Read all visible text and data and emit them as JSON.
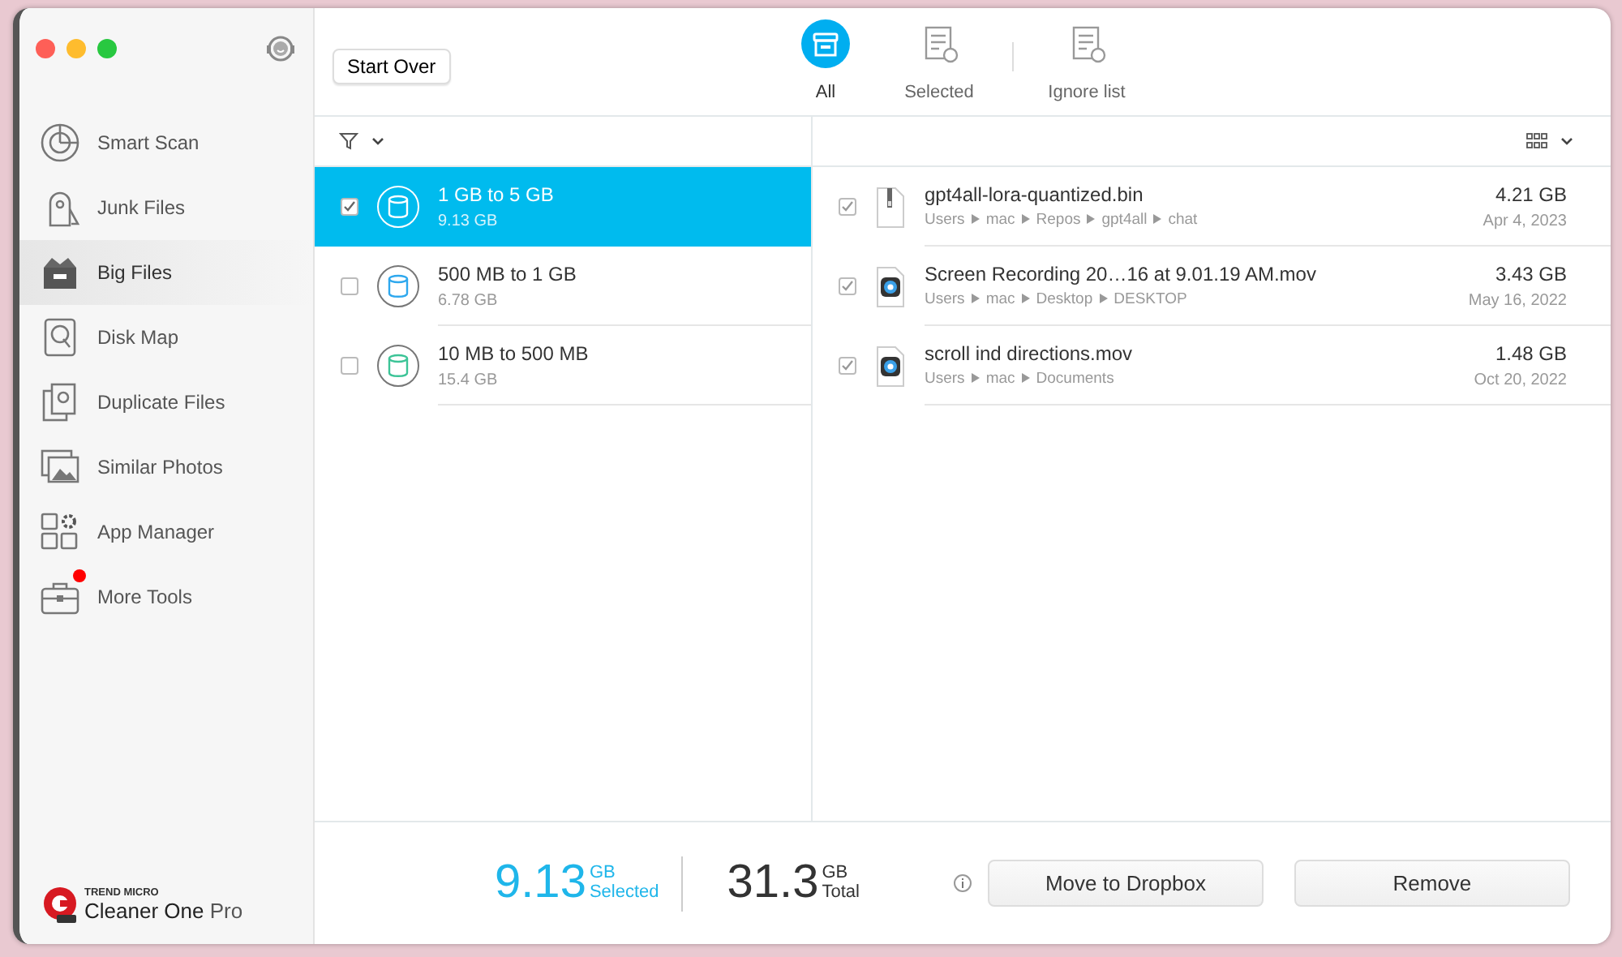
{
  "sidebar": {
    "items": [
      {
        "label": "Smart Scan",
        "selected": false,
        "badge": false
      },
      {
        "label": "Junk Files",
        "selected": false,
        "badge": false
      },
      {
        "label": "Big Files",
        "selected": true,
        "badge": false
      },
      {
        "label": "Disk Map",
        "selected": false,
        "badge": false
      },
      {
        "label": "Duplicate Files",
        "selected": false,
        "badge": false
      },
      {
        "label": "Similar Photos",
        "selected": false,
        "badge": false
      },
      {
        "label": "App Manager",
        "selected": false,
        "badge": false
      },
      {
        "label": "More Tools",
        "selected": false,
        "badge": true
      }
    ],
    "brand": {
      "company": "TREND MICRO",
      "product": "Cleaner One",
      "edition": "Pro"
    }
  },
  "toolbar": {
    "start_over": "Start Over",
    "tabs": [
      {
        "label": "All",
        "selected": true
      },
      {
        "label": "Selected",
        "selected": false
      },
      {
        "label": "Ignore list",
        "selected": false
      }
    ]
  },
  "groups": [
    {
      "label": "1 GB to 5 GB",
      "size": "9.13 GB",
      "checked": true,
      "selected": true,
      "color": "#ffffff"
    },
    {
      "label": "500 MB to 1 GB",
      "size": "6.78 GB",
      "checked": false,
      "selected": false,
      "color": "#2ea8ee"
    },
    {
      "label": "10 MB to 500 MB",
      "size": "15.4 GB",
      "checked": false,
      "selected": false,
      "color": "#3cc497"
    }
  ],
  "files": [
    {
      "kind": "bin",
      "name": "gpt4all-lora-quantized.bin",
      "path": [
        "Users",
        "mac",
        "Repos",
        "gpt4all",
        "chat"
      ],
      "size": "4.21 GB",
      "date": "Apr 4, 2023",
      "checked": true
    },
    {
      "kind": "mov",
      "name": "Screen Recording 20…16 at 9.01.19 AM.mov",
      "path": [
        "Users",
        "mac",
        "Desktop",
        "DESKTOP"
      ],
      "size": "3.43 GB",
      "date": "May 16, 2022",
      "checked": true
    },
    {
      "kind": "mov",
      "name": "scroll ind directions.mov",
      "path": [
        "Users",
        "mac",
        "Documents"
      ],
      "size": "1.48 GB",
      "date": "Oct 20, 2022",
      "checked": true
    }
  ],
  "footer": {
    "selected_value": "9.13",
    "selected_unit": "GB",
    "selected_label": "Selected",
    "total_value": "31.3",
    "total_unit": "GB",
    "total_label": "Total",
    "buttons": [
      "Move to Dropbox",
      "Remove"
    ]
  }
}
